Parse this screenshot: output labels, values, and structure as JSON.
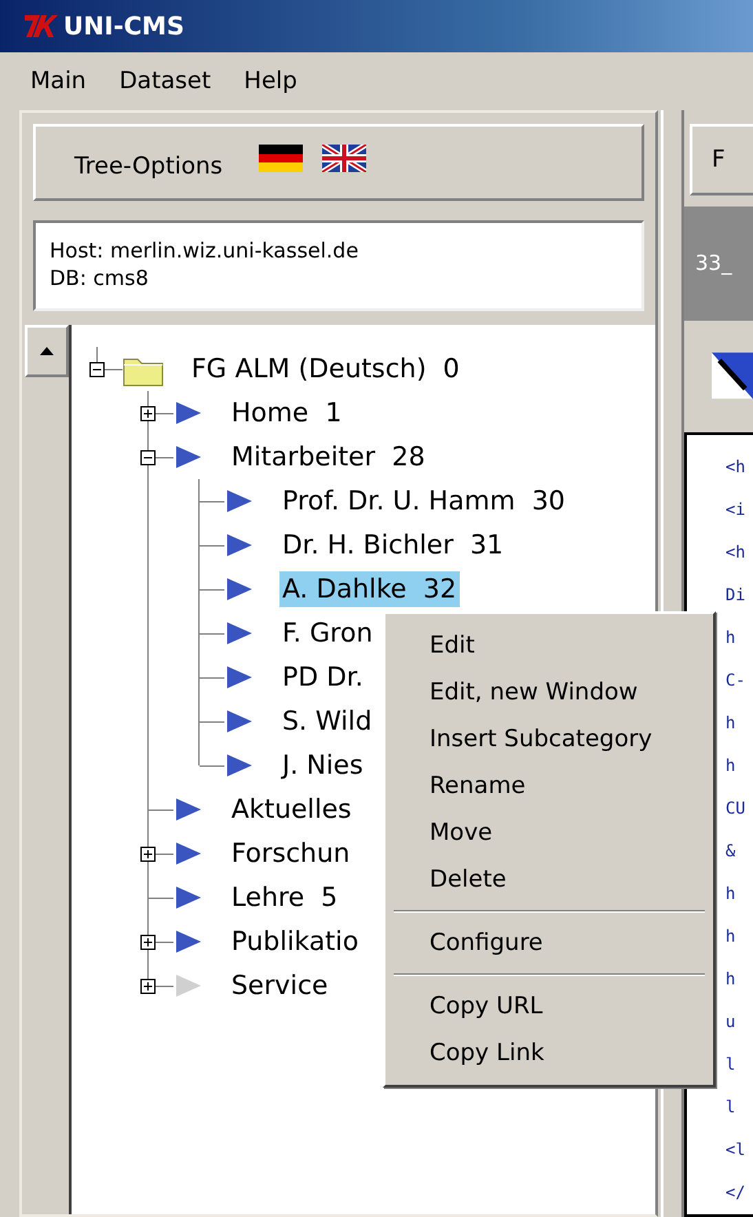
{
  "window": {
    "title": "UNI-CMS"
  },
  "menu_bar": [
    "Main",
    "Dataset",
    "Help"
  ],
  "tree_options": {
    "label": "Tree-Options"
  },
  "connection": {
    "host": "Host: merlin.wiz.uni-kassel.de",
    "db": "DB: cms8"
  },
  "tree": [
    {
      "label": "FG ALM (Deutsch)  0",
      "kind": "folder",
      "expanded": true,
      "selected": false,
      "children": [
        {
          "label": "Home  1",
          "kind": "page",
          "expanded": false,
          "selected": false,
          "disabled": false
        },
        {
          "label": "Mitarbeiter  28",
          "kind": "page",
          "expanded": true,
          "selected": false,
          "disabled": false,
          "children": [
            {
              "label": "Prof. Dr. U. Hamm  30",
              "kind": "page",
              "selected": false,
              "disabled": false
            },
            {
              "label": "Dr. H. Bichler  31",
              "kind": "page",
              "selected": false,
              "disabled": false
            },
            {
              "label": "A. Dahlke  32",
              "kind": "page",
              "selected": true,
              "disabled": false
            },
            {
              "label": "F. Gron",
              "kind": "page",
              "selected": false,
              "disabled": false
            },
            {
              "label": "PD Dr.",
              "kind": "page",
              "selected": false,
              "disabled": false
            },
            {
              "label": "S. Wild",
              "kind": "page",
              "selected": false,
              "disabled": false
            },
            {
              "label": "J. Nies",
              "kind": "page",
              "selected": false,
              "disabled": false
            }
          ]
        },
        {
          "label": "Aktuelles",
          "kind": "page",
          "selected": false,
          "disabled": false
        },
        {
          "label": "Forschun",
          "kind": "page",
          "expanded": false,
          "selected": false,
          "disabled": false
        },
        {
          "label": "Lehre  5",
          "kind": "page",
          "selected": false,
          "disabled": false
        },
        {
          "label": "Publikatio",
          "kind": "page",
          "expanded": false,
          "selected": false,
          "disabled": false
        },
        {
          "label": "Service",
          "kind": "page",
          "expanded": false,
          "selected": false,
          "disabled": true
        }
      ]
    }
  ],
  "context_menu": {
    "groups": [
      [
        "Edit",
        "Edit, new Window",
        "Insert Subcategory",
        "Rename",
        "Move",
        "Delete"
      ],
      [
        "Configure"
      ],
      [
        "Copy URL",
        "Copy Link"
      ]
    ]
  },
  "right_panel": {
    "tab": "F",
    "path": "33_",
    "code_lines": [
      "<h",
      "<i",
      "<h",
      "Di",
      "h",
      "C-",
      "h",
      "h",
      "CU",
      "&",
      "h",
      "h",
      "h",
      "u",
      "l",
      "l",
      "<l",
      "</"
    ]
  }
}
